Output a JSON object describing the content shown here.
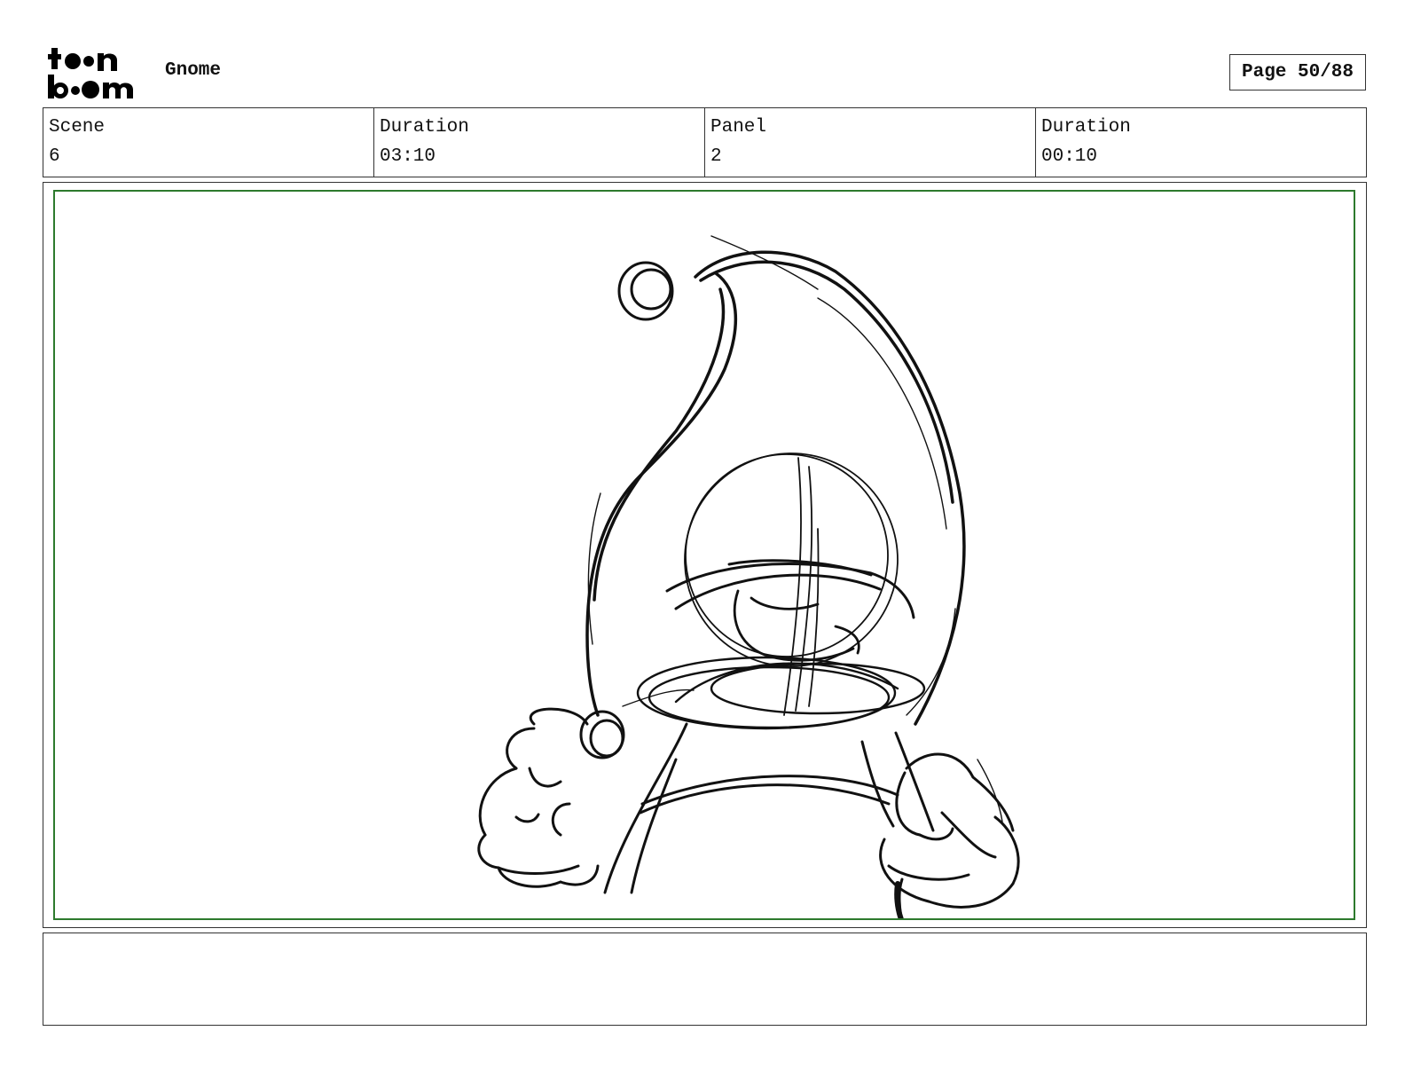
{
  "header": {
    "logo_text": "toon boom",
    "project_title": "Gnome",
    "page_label": "Page 50/88"
  },
  "info": {
    "scene_label": "Scene",
    "scene_value": "6",
    "scene_duration_label": "Duration",
    "scene_duration_value": "03:10",
    "panel_label": "Panel",
    "panel_value": "2",
    "panel_duration_label": "Duration",
    "panel_duration_value": "00:10"
  },
  "panel": {
    "safe_frame_color": "#2d7a2d",
    "sketch_subject": "gnome-sketch"
  },
  "notes": {
    "text": ""
  }
}
